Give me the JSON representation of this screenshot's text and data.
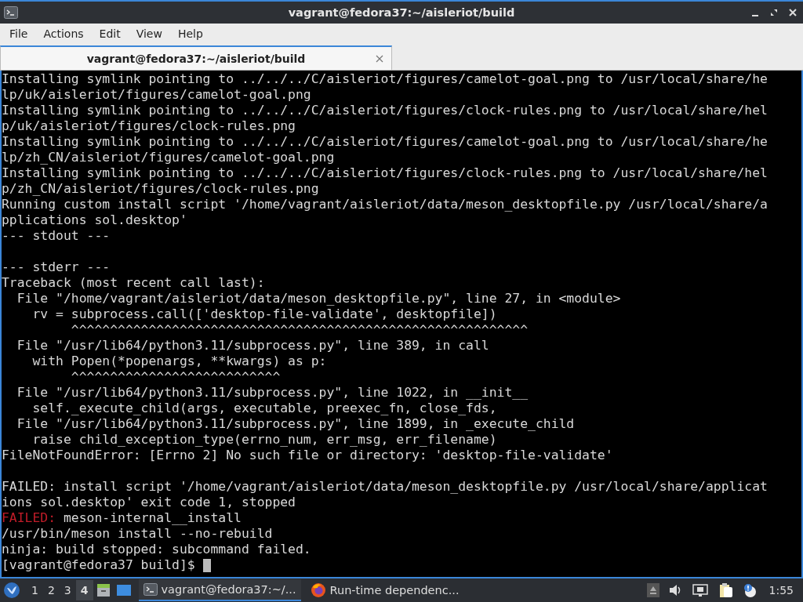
{
  "window": {
    "title": "vagrant@fedora37:~/aisleriot/build"
  },
  "menu": [
    "File",
    "Actions",
    "Edit",
    "View",
    "Help"
  ],
  "tabs": [
    {
      "label": "vagrant@fedora37:~/aisleriot/build",
      "selected": true
    }
  ],
  "terminal": {
    "lines": [
      {
        "text": "Installing symlink pointing to ../../../C/aisleriot/figures/camelot-goal.png to /usr/local/share/he"
      },
      {
        "text": "lp/uk/aisleriot/figures/camelot-goal.png"
      },
      {
        "text": "Installing symlink pointing to ../../../C/aisleriot/figures/clock-rules.png to /usr/local/share/hel"
      },
      {
        "text": "p/uk/aisleriot/figures/clock-rules.png"
      },
      {
        "text": "Installing symlink pointing to ../../../C/aisleriot/figures/camelot-goal.png to /usr/local/share/he"
      },
      {
        "text": "lp/zh_CN/aisleriot/figures/camelot-goal.png"
      },
      {
        "text": "Installing symlink pointing to ../../../C/aisleriot/figures/clock-rules.png to /usr/local/share/hel"
      },
      {
        "text": "p/zh_CN/aisleriot/figures/clock-rules.png"
      },
      {
        "text": "Running custom install script '/home/vagrant/aisleriot/data/meson_desktopfile.py /usr/local/share/a"
      },
      {
        "text": "pplications sol.desktop'"
      },
      {
        "text": "--- stdout ---"
      },
      {
        "kind": "blank"
      },
      {
        "text": "--- stderr ---"
      },
      {
        "text": "Traceback (most recent call last):"
      },
      {
        "text": "  File \"/home/vagrant/aisleriot/data/meson_desktopfile.py\", line 27, in <module>"
      },
      {
        "text": "    rv = subprocess.call(['desktop-file-validate', desktopfile])"
      },
      {
        "text": "         ^^^^^^^^^^^^^^^^^^^^^^^^^^^^^^^^^^^^^^^^^^^^^^^^^^^^^^^^^^^"
      },
      {
        "text": "  File \"/usr/lib64/python3.11/subprocess.py\", line 389, in call"
      },
      {
        "text": "    with Popen(*popenargs, **kwargs) as p:"
      },
      {
        "text": "         ^^^^^^^^^^^^^^^^^^^^^^^^^^^"
      },
      {
        "text": "  File \"/usr/lib64/python3.11/subprocess.py\", line 1022, in __init__"
      },
      {
        "text": "    self._execute_child(args, executable, preexec_fn, close_fds,"
      },
      {
        "text": "  File \"/usr/lib64/python3.11/subprocess.py\", line 1899, in _execute_child"
      },
      {
        "text": "    raise child_exception_type(errno_num, err_msg, err_filename)"
      },
      {
        "text": "FileNotFoundError: [Errno 2] No such file or directory: 'desktop-file-validate'"
      },
      {
        "kind": "blank"
      },
      {
        "text": "FAILED: install script '/home/vagrant/aisleriot/data/meson_desktopfile.py /usr/local/share/applicat"
      },
      {
        "text": "ions sol.desktop' exit code 1, stopped"
      },
      {
        "kind": "error",
        "prefix": "FAILED:",
        "text": " meson-internal__install"
      },
      {
        "text": "/usr/bin/meson install --no-rebuild"
      },
      {
        "text": "ninja: build stopped: subcommand failed."
      },
      {
        "kind": "prompt",
        "text": "[vagrant@fedora37 build]$ ",
        "cursor": true
      }
    ]
  },
  "taskbar": {
    "workspaces": [
      {
        "label": "1",
        "selected": false
      },
      {
        "label": "2",
        "selected": false
      },
      {
        "label": "3",
        "selected": false
      },
      {
        "label": "4",
        "selected": true
      }
    ],
    "tasks": [
      {
        "kind": "terminal",
        "label": "vagrant@fedora37:~/...",
        "selected": true
      },
      {
        "kind": "browser",
        "label": "Run-time dependenc...",
        "selected": false
      }
    ],
    "clock": "1:55"
  }
}
